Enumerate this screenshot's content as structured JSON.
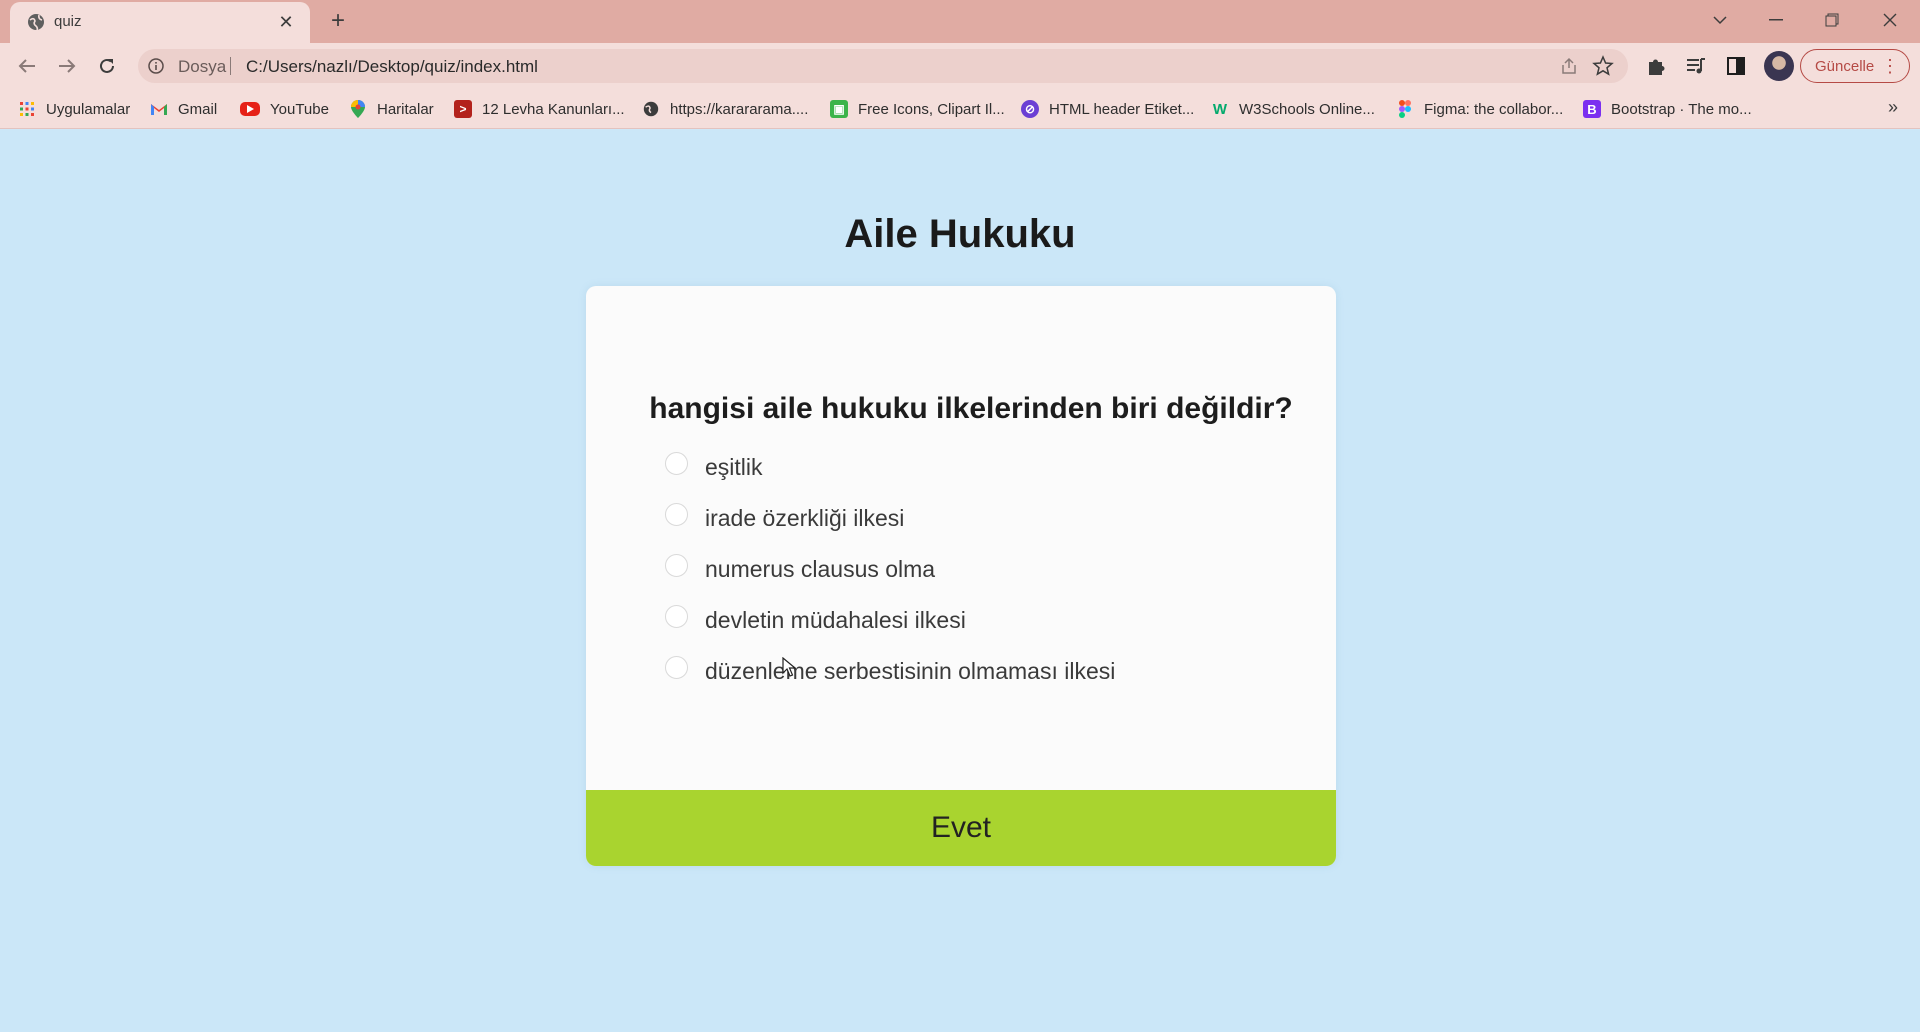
{
  "browser": {
    "tab_title": "quiz",
    "new_tab_symbol": "+",
    "address_scheme": "Dosya",
    "url": "C:/Users/nazlı/Desktop/quiz/index.html",
    "update_label": "Güncelle",
    "bookmarks": [
      {
        "label": "Uygulamalar",
        "icon": "apps-grid-icon"
      },
      {
        "label": "Gmail",
        "icon": "gmail-icon"
      },
      {
        "label": "YouTube",
        "icon": "youtube-icon"
      },
      {
        "label": "Haritalar",
        "icon": "maps-icon"
      },
      {
        "label": "12 Levha Kanunları...",
        "icon": "levha-icon"
      },
      {
        "label": "https://karararama....",
        "icon": "globe-icon"
      },
      {
        "label": "Free Icons, Clipart Il...",
        "icon": "icons-site-icon"
      },
      {
        "label": "HTML header Etiket...",
        "icon": "html-site-icon"
      },
      {
        "label": "W3Schools Online...",
        "icon": "w3schools-icon"
      },
      {
        "label": "Figma: the collabor...",
        "icon": "figma-icon"
      },
      {
        "label": "Bootstrap · The mo...",
        "icon": "bootstrap-icon"
      }
    ]
  },
  "quiz": {
    "title": "Aile Hukuku",
    "question": "hangisi aile hukuku ilkelerinden biri değildir?",
    "answers": [
      "eşitlik",
      "irade özerkliği ilkesi",
      "numerus clausus olma",
      "devletin müdahalesi ilkesi",
      "düzenleme serbestisinin olmaması ilkesi"
    ],
    "submit_label": "Evet"
  },
  "colors": {
    "tabstrip": "#e0aba3",
    "toolbar": "#f4dedb",
    "page_background": "#cbe7f8",
    "card": "#fbfbfb",
    "submit_button": "#a9d42f",
    "update_accent": "#b54a45"
  }
}
